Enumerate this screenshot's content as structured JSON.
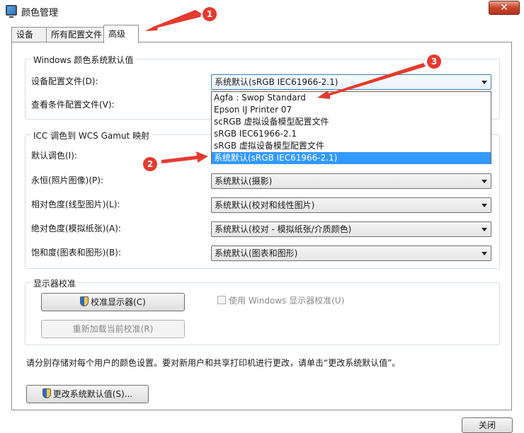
{
  "window": {
    "title": "颜色管理",
    "close_label": "✕"
  },
  "tabs": [
    {
      "label": "设备"
    },
    {
      "label": "所有配置文件"
    },
    {
      "label": "高级"
    }
  ],
  "windows_defaults": {
    "title": "Windows 颜色系统默认值",
    "device_profile_label": "设备配置文件(D):",
    "device_profile_value": "系统默认(sRGB IEC61966-2.1)",
    "viewing_conditions_label": "查看条件配置文件(V):"
  },
  "dropdown": {
    "items": [
      "Agfa : Swop Standard",
      "Epson IJ Printer 07",
      "scRGB 虚拟设备模型配置文件",
      "sRGB IEC61966-2.1",
      "sRGB 虚拟设备模型配置文件",
      "系统默认(sRGB IEC61966-2.1)"
    ],
    "selected_index": 5
  },
  "icc_mapping": {
    "title": "ICC 调色到 WCS Gamut 映射",
    "rows": [
      {
        "label": "默认调色(I):",
        "value": ""
      },
      {
        "label": "永恒(照片图像)(P):",
        "value": "系统默认(摄影)"
      },
      {
        "label": "相对色度(线型图片)(L):",
        "value": "系统默认(校对和线性图片)"
      },
      {
        "label": "绝对色度(模拟纸张)(A):",
        "value": "系统默认(校对 - 模拟纸张/介质颜色)"
      },
      {
        "label": "饱和度(图表和图形)(B):",
        "value": "系统默认(图表和图形)"
      }
    ]
  },
  "calibration": {
    "title": "显示器校准",
    "calibrate_button": "校准显示器(C)",
    "reload_button": "重新加载当前校准(R)",
    "use_windows_calibration": "使用 Windows 显示器校准(U)"
  },
  "footer": {
    "note": "请分别存储对每个用户的颜色设置。要对新用户和共享打印机进行更改，请单击“更改系统默认值”。",
    "change_defaults_button": "更改系统默认值(S)...",
    "close_button": "关闭"
  },
  "annotations": {
    "badges": [
      "1",
      "2",
      "3"
    ],
    "color": "#e63a2e"
  }
}
